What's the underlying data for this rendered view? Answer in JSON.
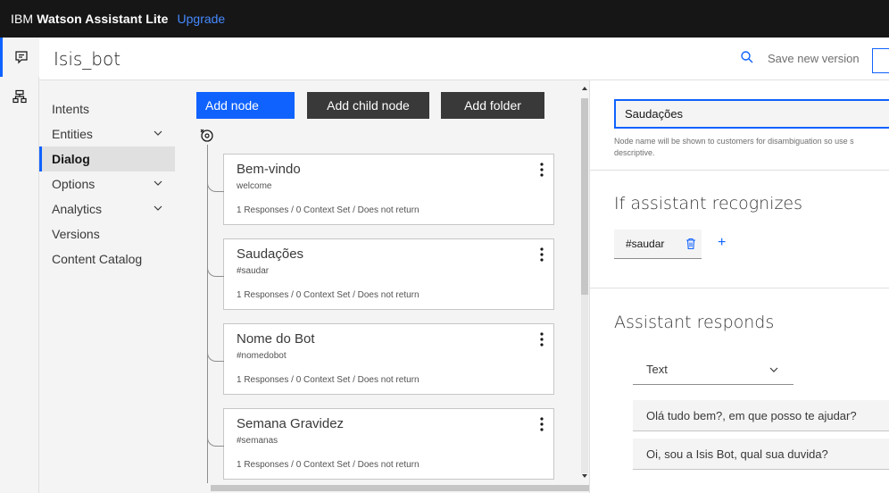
{
  "topbar": {
    "brand_prefix": "IBM",
    "brand_name": "Watson Assistant Lite",
    "upgrade": "Upgrade"
  },
  "rail": {
    "items": [
      {
        "icon": "dialog-icon"
      },
      {
        "icon": "tree-structure-icon"
      }
    ]
  },
  "header": {
    "bot_name": "Isis_bot",
    "save_label": "Save new version"
  },
  "nav": {
    "items": [
      {
        "label": "Intents",
        "expandable": false,
        "active": false
      },
      {
        "label": "Entities",
        "expandable": true,
        "active": false
      },
      {
        "label": "Dialog",
        "expandable": false,
        "active": true
      },
      {
        "label": "Options",
        "expandable": true,
        "active": false
      },
      {
        "label": "Analytics",
        "expandable": true,
        "active": false
      },
      {
        "label": "Versions",
        "expandable": false,
        "active": false
      },
      {
        "label": "Content Catalog",
        "expandable": false,
        "active": false
      }
    ]
  },
  "toolbar": {
    "add_node": "Add node",
    "add_child_node": "Add child node",
    "add_folder": "Add folder"
  },
  "nodes": [
    {
      "title": "Bem-vindo",
      "condition": "welcome",
      "meta": "1 Responses / 0 Context Set / Does not return"
    },
    {
      "title": "Saudações",
      "condition": "#saudar",
      "meta": "1 Responses / 0 Context Set / Does not return"
    },
    {
      "title": "Nome do Bot",
      "condition": "#nomedobot",
      "meta": "1 Responses / 0 Context Set / Does not return"
    },
    {
      "title": "Semana Gravidez",
      "condition": "#semanas",
      "meta": "1 Responses / 0 Context Set / Does not return"
    }
  ],
  "editor": {
    "node_name": "Saudações",
    "help_text": "Node name will be shown to customers for disambiguation so use s descriptive.",
    "recognizes_title": "If assistant recognizes",
    "condition_tag": "#saudar",
    "add_symbol": "+",
    "responds_title": "Assistant responds",
    "response_type": "Text",
    "responses": [
      "Olá tudo bem?, em que posso te ajudar?",
      "Oi, sou a Isis Bot, qual sua duvida?"
    ]
  },
  "colors": {
    "accent": "#0f62fe",
    "topbar": "#161616",
    "dark_button": "#393939",
    "panel": "#f4f4f4"
  }
}
